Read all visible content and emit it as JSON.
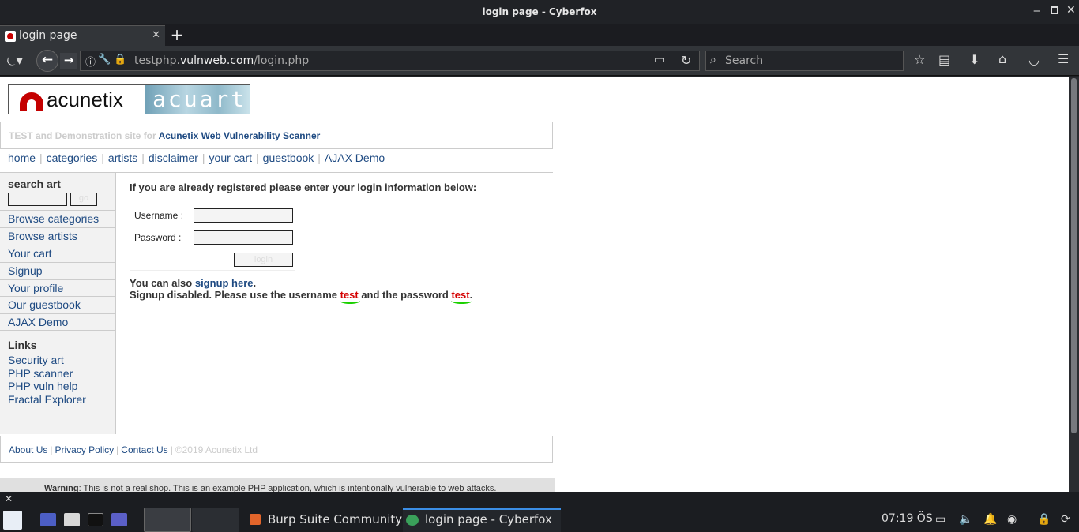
{
  "window": {
    "title": "login page - Cyberfox"
  },
  "tab": {
    "label": "login page"
  },
  "address": {
    "prefix": "testphp.",
    "domain": "vulnweb.com",
    "path": "/login.php"
  },
  "search": {
    "placeholder": "Search"
  },
  "site": {
    "logo_left": "acunetix",
    "logo_right": "acuart",
    "tagline_prefix": "TEST and Demonstration site for ",
    "tagline_link": "Acunetix Web Vulnerability Scanner",
    "nav": [
      "home",
      "categories",
      "artists",
      "disclaimer",
      "your cart",
      "guestbook",
      "AJAX Demo"
    ],
    "search_heading": "search art",
    "search_button": "go",
    "side_items": [
      "Browse categories",
      "Browse artists",
      "Your cart",
      "Signup",
      "Your profile",
      "Our guestbook",
      "AJAX Demo"
    ],
    "links_heading": "Links",
    "links": [
      "Security art",
      "PHP scanner",
      "PHP vuln help",
      "Fractal Explorer"
    ],
    "intro": "If you are already registered please enter your login information below:",
    "username_label": "Username :",
    "password_label": "Password :",
    "login_button": "login",
    "also_prefix": "You can also ",
    "also_link": "signup here",
    "also_suffix": ".",
    "disabled_prefix": "Signup disabled. Please use the username ",
    "disabled_user": "test",
    "disabled_mid": " and the password ",
    "disabled_pass": "test",
    "disabled_suffix": ".",
    "footer": [
      "About Us",
      "Privacy Policy",
      "Contact Us"
    ],
    "copyright": "©2019 Acunetix Ltd",
    "warning_bold": "Warning",
    "warning_text": ": This is not a real shop. This is an example PHP application, which is intentionally vulnerable to web attacks."
  },
  "taskbar": {
    "tasks": [
      "Burp Suite Community E...",
      "login page - Cyberfox"
    ],
    "clock": "07:19 ÖS"
  }
}
